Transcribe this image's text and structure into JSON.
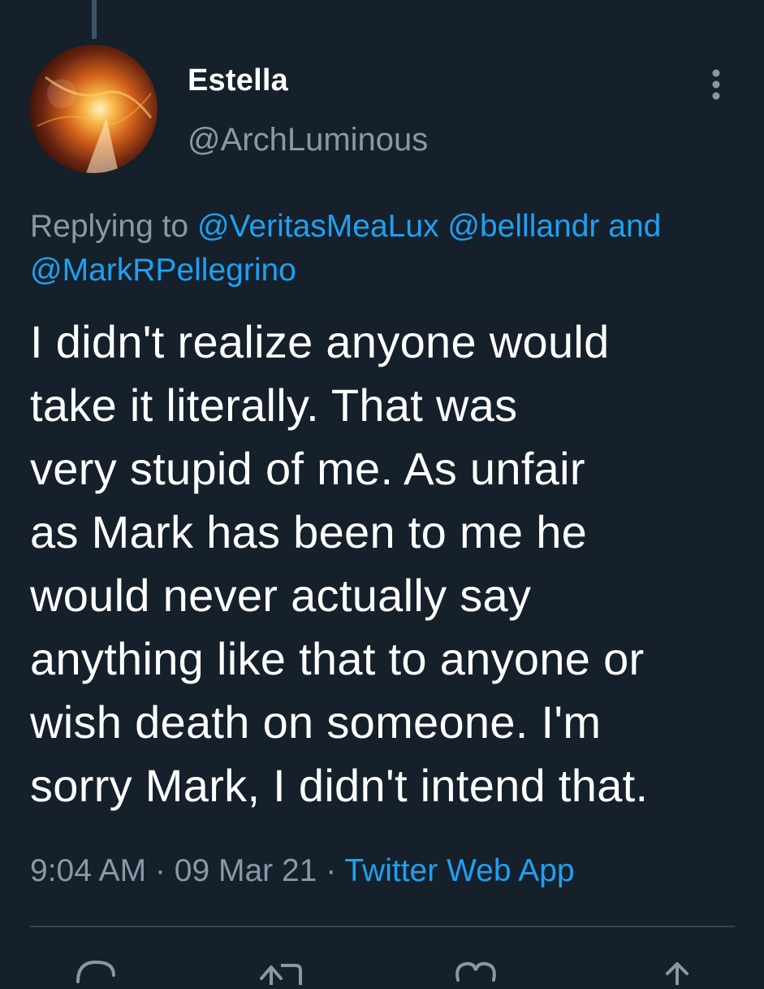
{
  "tweet": {
    "display_name": "Estella",
    "handle": "@ArchLuminous",
    "replying_prefix": "Replying to",
    "mentions": [
      "@VeritasMeaLux",
      "@belllandr",
      "@MarkRPellegrino"
    ],
    "mention_joiner": "and",
    "text": "I didn't realize anyone would\ntake it literally. That was\nvery stupid of me. As unfair\nas Mark has been to me he\nwould never actually say\nanything like that to anyone or\nwish death on someone. I'm\nsorry Mark, I didn't intend that.",
    "time": "9:04 AM",
    "separator": "·",
    "date": "09 Mar 21",
    "source_app": "Twitter Web App"
  },
  "icons": {
    "more": "more-vertical-icon",
    "reply": "reply-icon",
    "retweet": "retweet-icon",
    "like": "heart-icon",
    "share": "share-icon"
  },
  "colors": {
    "background": "#15202b",
    "secondary_text": "#8899a6",
    "link": "#1da1f2",
    "divider": "#38444d"
  }
}
